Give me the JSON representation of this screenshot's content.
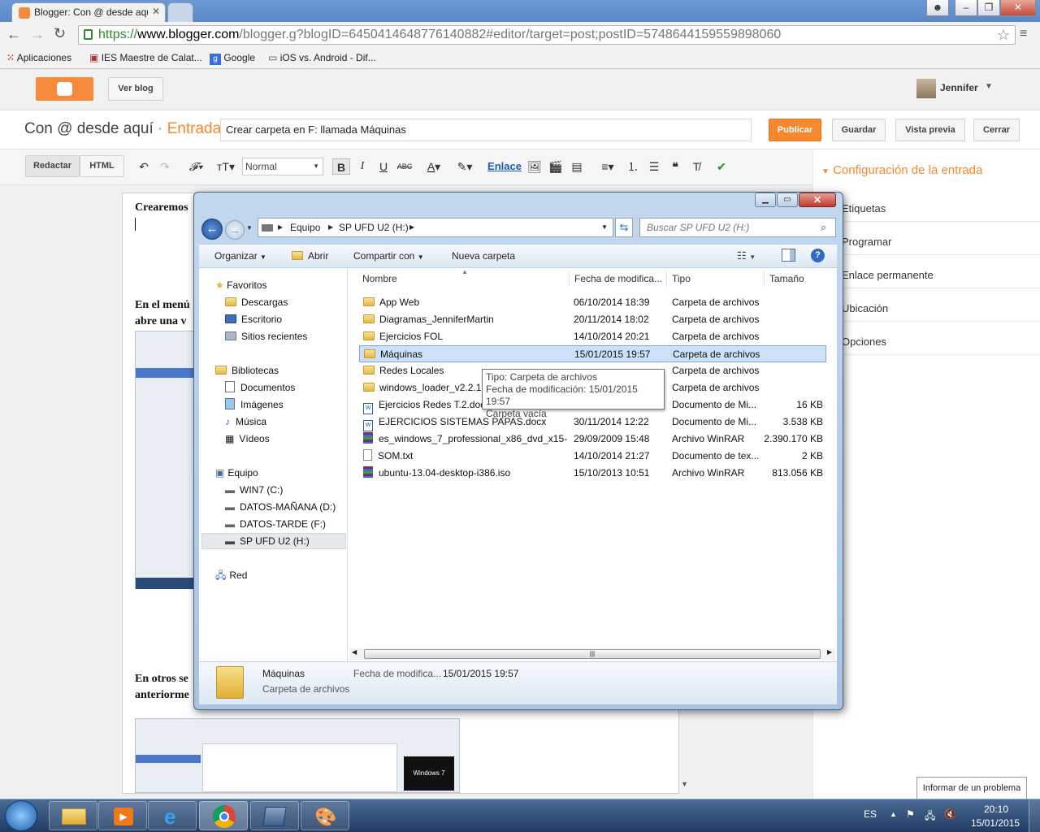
{
  "browser": {
    "tab_title": "Blogger: Con @ desde aqú",
    "url_prefix": "https://",
    "url_host": "www.blogger.com",
    "url_rest": "/blogger.g?blogID=6450414648776140882#editor/target=post;postID=5748644159559898060",
    "bookmarks": [
      "Aplicaciones",
      "IES Maestre de Calat...",
      "Google",
      "iOS vs. Android - Dif..."
    ]
  },
  "blogger": {
    "view_blog": "Ver blog",
    "user": "Jennifer",
    "blog_title": "Con @ desde aquí",
    "separator": "·",
    "section": "Entrada",
    "post_title": "Crear carpeta en F: llamada Máquinas",
    "publish": "Publicar",
    "save": "Guardar",
    "preview": "Vista previa",
    "close": "Cerrar",
    "mode_compose": "Redactar",
    "mode_html": "HTML",
    "font_size": "Normal",
    "link": "Enlace",
    "editor_text_1": "Crearemos",
    "editor_text_2a": "En el menú",
    "editor_text_2b": "abre una v",
    "editor_text_3a": "En otros se",
    "editor_text_3b": "anteriorme",
    "settings_title": "Configuración de la entrada",
    "settings_items": [
      "Etiquetas",
      "Programar",
      "Enlace permanente",
      "Ubicación",
      "Opciones"
    ],
    "thumb_label": "Windows 7"
  },
  "explorer": {
    "breadcrumb": [
      "Equipo",
      "SP UFD U2 (H:)"
    ],
    "search_placeholder": "Buscar SP UFD U2 (H:)",
    "commands": {
      "organize": "Organizar",
      "open": "Abrir",
      "share": "Compartir con",
      "new_folder": "Nueva carpeta"
    },
    "nav": {
      "favorites": "Favoritos",
      "favorites_items": [
        "Descargas",
        "Escritorio",
        "Sitios recientes"
      ],
      "libraries": "Bibliotecas",
      "libraries_items": [
        "Documentos",
        "Imágenes",
        "Música",
        "Vídeos"
      ],
      "computer": "Equipo",
      "computer_items": [
        "WIN7 (C:)",
        "DATOS-MAÑANA (D:)",
        "DATOS-TARDE (F:)",
        "SP UFD U2 (H:)"
      ],
      "network": "Red"
    },
    "columns": {
      "name": "Nombre",
      "date": "Fecha de modifica...",
      "type": "Tipo",
      "size": "Tamaño"
    },
    "files": [
      {
        "name": "App Web",
        "date": "06/10/2014 18:39",
        "type": "Carpeta de archivos",
        "size": "",
        "icon": "folder"
      },
      {
        "name": "Diagramas_JenniferMartin",
        "date": "20/11/2014 18:02",
        "type": "Carpeta de archivos",
        "size": "",
        "icon": "folder"
      },
      {
        "name": "Ejercicios FOL",
        "date": "14/10/2014 20:21",
        "type": "Carpeta de archivos",
        "size": "",
        "icon": "folder"
      },
      {
        "name": "Máquinas",
        "date": "15/01/2015 19:57",
        "type": "Carpeta de archivos",
        "size": "",
        "icon": "folder"
      },
      {
        "name": "Redes Locales",
        "date": "",
        "type": "Carpeta de archivos",
        "size": "",
        "icon": "folder"
      },
      {
        "name": "windows_loader_v2.2.1",
        "date": "",
        "type": "Carpeta de archivos",
        "size": "",
        "icon": "folder"
      },
      {
        "name": "Ejercicios Redes T.2.docx",
        "date": "",
        "type": "Documento de Mi...",
        "size": "16 KB",
        "icon": "doc"
      },
      {
        "name": "EJERCICIOS SISTEMAS PAPAS.docx",
        "date": "30/11/2014 12:22",
        "type": "Documento de Mi...",
        "size": "3.538 KB",
        "icon": "doc"
      },
      {
        "name": "es_windows_7_professional_x86_dvd_x15-...",
        "date": "29/09/2009 15:48",
        "type": "Archivo WinRAR",
        "size": "2.390.170 KB",
        "icon": "rar"
      },
      {
        "name": "SOM.txt",
        "date": "14/10/2014 21:27",
        "type": "Documento de tex...",
        "size": "2 KB",
        "icon": "txt"
      },
      {
        "name": "ubuntu-13.04-desktop-i386.iso",
        "date": "15/10/2013 10:51",
        "type": "Archivo WinRAR",
        "size": "813.056 KB",
        "icon": "rar"
      }
    ],
    "selected_index": 3,
    "tooltip": {
      "line1": "Tipo: Carpeta de archivos",
      "line2": "Fecha de modificación: 15/01/2015 19:57",
      "line3": "Carpeta vacía"
    },
    "details": {
      "name": "Máquinas",
      "type": "Carpeta de archivos",
      "date_label": "Fecha de modifica...",
      "date": "15/01/2015 19:57"
    }
  },
  "taskbar": {
    "lang": "ES",
    "time": "20:10",
    "date": "15/01/2015",
    "report_tip": "Informar de un problema"
  },
  "colors": {
    "blogger_orange": "#f58a3b",
    "accent_orange": "#f6892d",
    "selection": "#cce1f7"
  }
}
